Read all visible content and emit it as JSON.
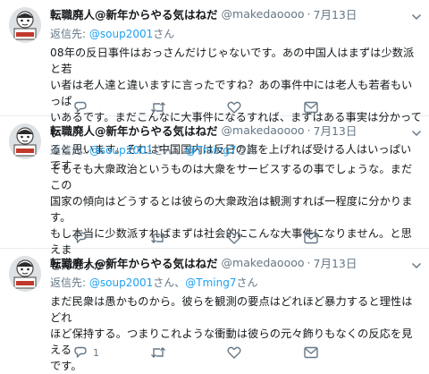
{
  "tweets": [
    {
      "display_name": "転職廃人@新年からやる気はねだ",
      "handle": "@makedaoooo",
      "separator": "·",
      "date": "7月13日",
      "reply_prefix": "返信先:",
      "mentions": [
        "@soup2001"
      ],
      "mention_joiner": "さん、",
      "mention_suffix": "さん",
      "lines": [
        "08年の反日事件はおっさんだけじゃないです。あの中国人はまずは少数派と若",
        "い者は老人達と違いますに言ったですね？あの事件中には老人も若者もいっぱ",
        "いあるです。まだこんなに大事件になるすれば、まずはある事実は分かってい",
        "ると思います。それは中国国内は反日の旗を上げれば受ける人はいっぱいです"
      ],
      "actions": {
        "reply_count": "",
        "retweet_count": "",
        "like_count": ""
      }
    },
    {
      "display_name": "転職廃人@新年からやる気はねだ",
      "handle": "@makedaoooo",
      "separator": "·",
      "date": "7月13日",
      "reply_prefix": "返信先:",
      "mentions": [
        "@soup2001",
        "@Tming7"
      ],
      "mention_joiner": "さん、",
      "mention_suffix": "さん",
      "lines": [
        "そもそも大衆政治というものは大衆をサービスするの事でしょうな。まだこの",
        "国家の傾向はどうするとは彼らの大衆政治は観測すれば一程度に分かります。",
        "もし本当に少数派すればまずは社会的にこんな大事件になりません。と思えま",
        "せんですか？"
      ],
      "actions": {
        "reply_count": "",
        "retweet_count": "",
        "like_count": ""
      }
    },
    {
      "display_name": "転職廃人@新年からやる気はねだ",
      "handle": "@makedaoooo",
      "separator": "·",
      "date": "7月13日",
      "reply_prefix": "返信先:",
      "mentions": [
        "@soup2001",
        "@Tming7"
      ],
      "mention_joiner": "さん、",
      "mention_suffix": "さん",
      "lines": [
        "まだ民衆は愚かものから。彼らを観測の要点はどれほど暴力すると理性はどれ",
        "ほど保持する。つまりこれような衝動は彼らの元々飾りもなくの反応を見える",
        "です。"
      ],
      "actions": {
        "reply_count": "1",
        "retweet_count": "",
        "like_count": ""
      }
    }
  ]
}
